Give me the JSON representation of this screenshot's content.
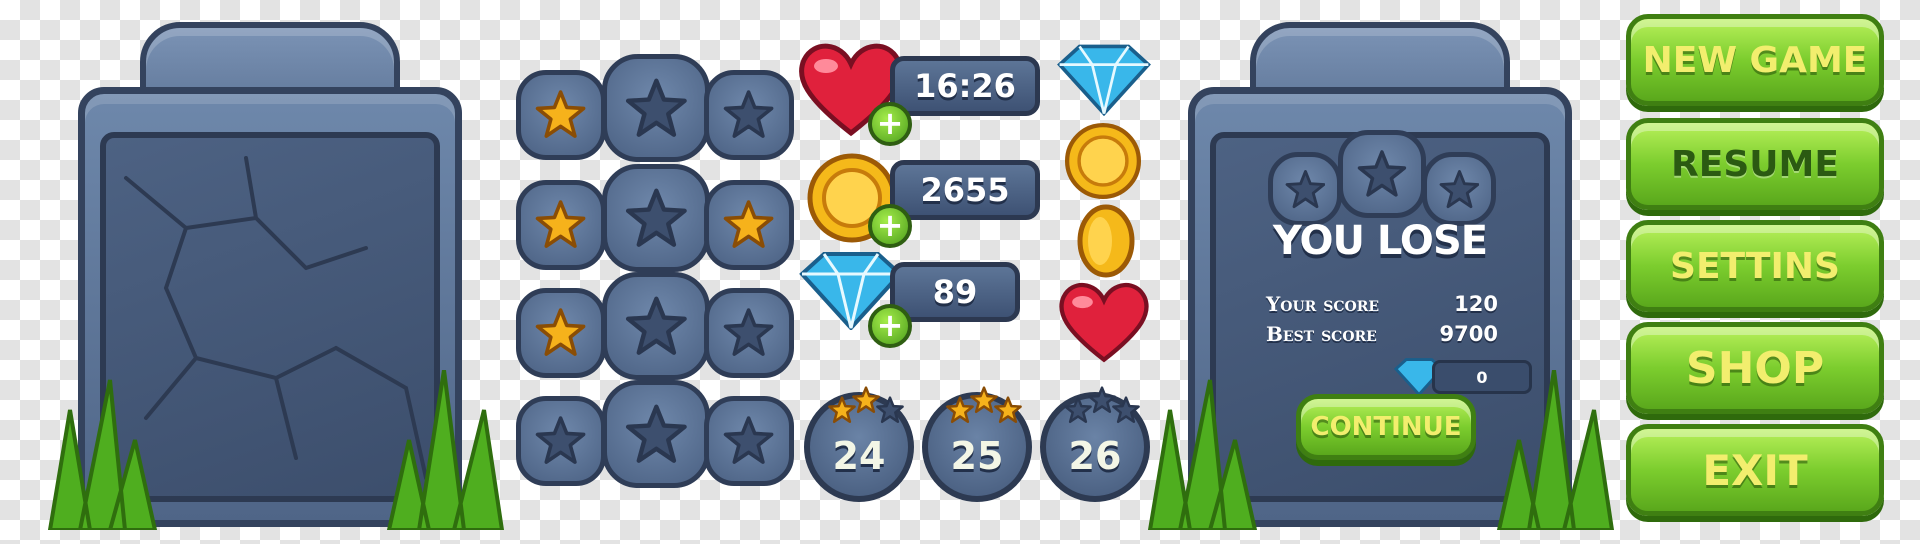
{
  "counters": [
    {
      "value": "16:26",
      "icon": "heart-icon"
    },
    {
      "value": "2655",
      "icon": "coin-icon"
    },
    {
      "value": "89",
      "icon": "gem-icon"
    }
  ],
  "levels": [
    {
      "number": "24",
      "stars_earned": 2
    },
    {
      "number": "25",
      "stars_earned": 3
    },
    {
      "number": "26",
      "stars_earned": 0
    }
  ],
  "star_rows": [
    {
      "stars_earned": 1
    },
    {
      "stars_earned": 2
    },
    {
      "stars_earned": 1
    },
    {
      "stars_earned": 0
    }
  ],
  "lose_dialog": {
    "title": "YOU LOSE",
    "your_score_label": "Your score",
    "your_score_value": "120",
    "best_score_label": "Best score",
    "best_score_value": "9700",
    "gems_value": "0",
    "stars_earned": 0,
    "continue_label": "CONTINUE"
  },
  "menu": {
    "new_game": "NEW GAME",
    "resume": "RESUME",
    "settings": "SETTINS",
    "shop": "SHOP",
    "exit": "EXIT"
  },
  "colors": {
    "stone": "#5b7294",
    "stone_dark": "#34435e",
    "button_green": "#7ccd2e",
    "button_text": "#f2ee6e",
    "star_gold": "#f6b21b"
  }
}
